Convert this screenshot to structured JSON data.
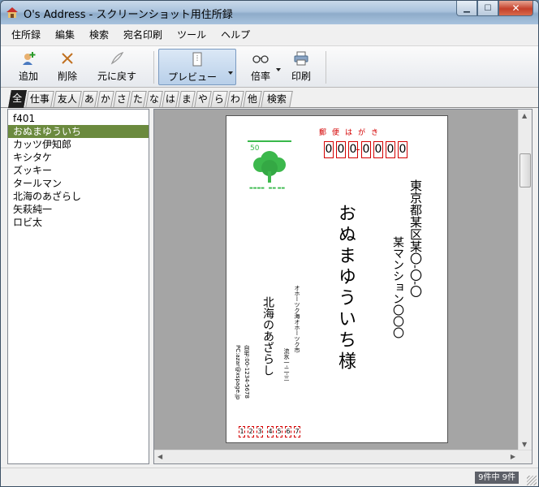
{
  "window": {
    "title": "O's Address - スクリーンショット用住所録"
  },
  "menu": [
    "住所録",
    "編集",
    "検索",
    "宛名印刷",
    "ツール",
    "ヘルプ"
  ],
  "toolbar": {
    "add": "追加",
    "delete": "削除",
    "undo": "元に戻す",
    "preview": "プレビュー",
    "zoom": "倍率",
    "print": "印刷"
  },
  "tabs": [
    "全",
    "仕事",
    "友人",
    "あ",
    "か",
    "さ",
    "た",
    "な",
    "は",
    "ま",
    "や",
    "ら",
    "わ",
    "他",
    "検索"
  ],
  "contacts": [
    "f401",
    "おぬまゆういち",
    "カッツ伊知郎",
    "キシタケ",
    "ズッキー",
    "タールマン",
    "北海のあざらし",
    "矢萩純一",
    "ロビ太"
  ],
  "card": {
    "postcard_label": "郵便はがき",
    "zip_digits": [
      "0",
      "0",
      "0",
      "0",
      "0",
      "0",
      "0"
    ],
    "stamp_value": "50",
    "recipient_address_1": "東京都某区某〇-〇-〇",
    "recipient_address_2": "某マンション〇〇〇",
    "recipient_name": "おぬまゆういち様",
    "sender_address_1": "オホーツク海オホーツク市",
    "sender_address_2": "流氷一-二-三",
    "sender_name": "北海のあざらし",
    "sender_phone": "自宅:00-1234-5678",
    "sender_email": "PC:azar@xspage.jp",
    "sender_zip_digits": [
      "1",
      "2",
      "3",
      "4",
      "5",
      "6",
      "7"
    ]
  },
  "status": {
    "count": "9件中 9件"
  },
  "colors": {
    "selection": "#6b8a3e",
    "postal_red": "#d40000",
    "stamp_green": "#38b84a"
  }
}
